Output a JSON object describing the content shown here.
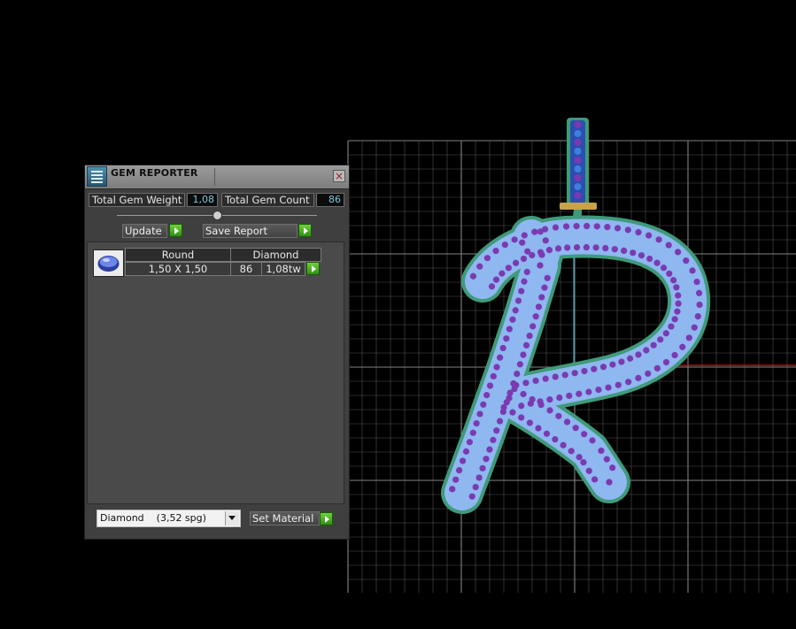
{
  "panel": {
    "title": "GEM REPORTER",
    "close_symbol": "×",
    "icon": "gem-reporter-app-icon"
  },
  "totals": {
    "weight_label": "Total Gem Weight",
    "weight_value": "1,08",
    "count_label": "Total Gem Count",
    "count_value": "86"
  },
  "actions": {
    "update_label": "Update",
    "save_report_label": "Save Report"
  },
  "gem_table": {
    "columns": [
      "Round",
      "Diamond"
    ],
    "row": {
      "size": "1,50 X 1,50",
      "count": "86",
      "weight": "1,08tw"
    },
    "thumbnail_icon": "round-gem-icon"
  },
  "material": {
    "selected": "Diamond    (3,52 spg)",
    "set_label": "Set Material"
  },
  "viewport": {
    "grid_color": "#8a8a8a",
    "gem_color": "#8fb7f0",
    "stone_color": "#7a3ab0",
    "outline_color": "#3f9a7a",
    "axis_x_color": "#c02020",
    "axis_y_color": "#2fa8b8"
  }
}
